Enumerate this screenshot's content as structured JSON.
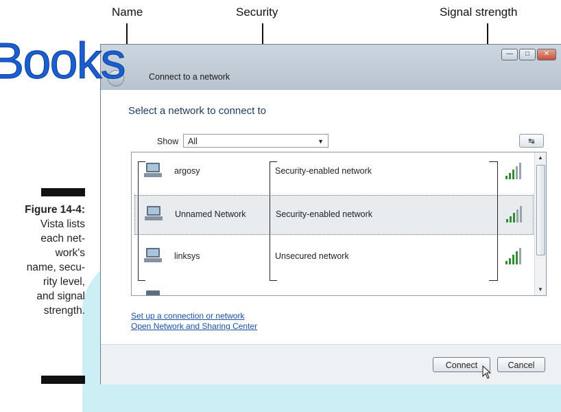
{
  "watermark": {
    "logo_text": "Books"
  },
  "callouts": {
    "name": "Name",
    "security": "Security",
    "signal": "Signal strength"
  },
  "caption": {
    "figure": "Figure 14-4",
    "text_lines": [
      "Vista lists",
      "each net-",
      "work's",
      "name, secu-",
      "rity level,",
      "and signal",
      "strength."
    ]
  },
  "window": {
    "title": "Connect to a network",
    "heading": "Select a network to connect to",
    "show_label": "Show",
    "show_value": "All",
    "networks": [
      {
        "name": "argosy",
        "security": "Security-enabled network",
        "signal_bars": 5,
        "selected": false
      },
      {
        "name": "Unnamed Network",
        "security": "Security-enabled network",
        "signal_bars": 5,
        "selected": true
      },
      {
        "name": "linksys",
        "security": "Unsecured network",
        "signal_bars": 5,
        "selected": false
      }
    ],
    "links": {
      "setup": "Set up a connection or network",
      "sharing": "Open Network and Sharing Center"
    },
    "buttons": {
      "connect": "Connect",
      "cancel": "Cancel"
    },
    "icons": {
      "back": "back-arrow-icon",
      "refresh": "refresh-icon",
      "network": "network-computer-icon",
      "signal": "signal-bars-icon"
    }
  }
}
